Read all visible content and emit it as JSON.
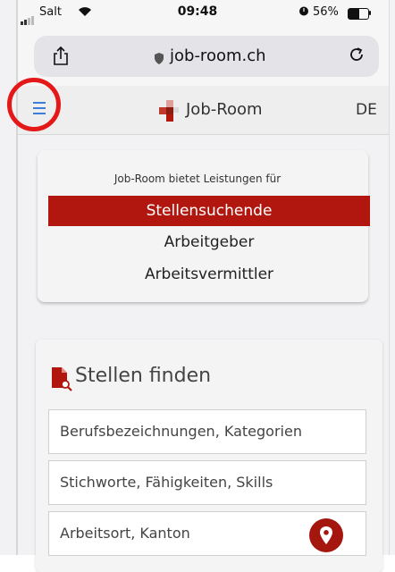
{
  "status_bar": {
    "carrier": "Salt",
    "time": "09:48",
    "battery_percent": "56%",
    "battery_level": 0.56
  },
  "browser": {
    "url": "job-room.ch"
  },
  "app_header": {
    "logo_text": "Job-Room",
    "language": "DE"
  },
  "audience_card": {
    "intro": "Job-Room bietet Leistungen für",
    "items": [
      {
        "label": "Stellensuchende",
        "active": true
      },
      {
        "label": "Arbeitgeber",
        "active": false
      },
      {
        "label": "Arbeitsvermittler",
        "active": false
      }
    ]
  },
  "search_card": {
    "title": "Stellen finden",
    "fields": [
      "Berufsbezeichnungen, Kategorien",
      "Stichworte, Fähigkeiten, Skills",
      "Arbeitsort, Kanton"
    ]
  },
  "colors": {
    "brand_red": "#b1170f",
    "menu_blue": "#3b7dd8",
    "highlight_circle": "#e41818"
  }
}
